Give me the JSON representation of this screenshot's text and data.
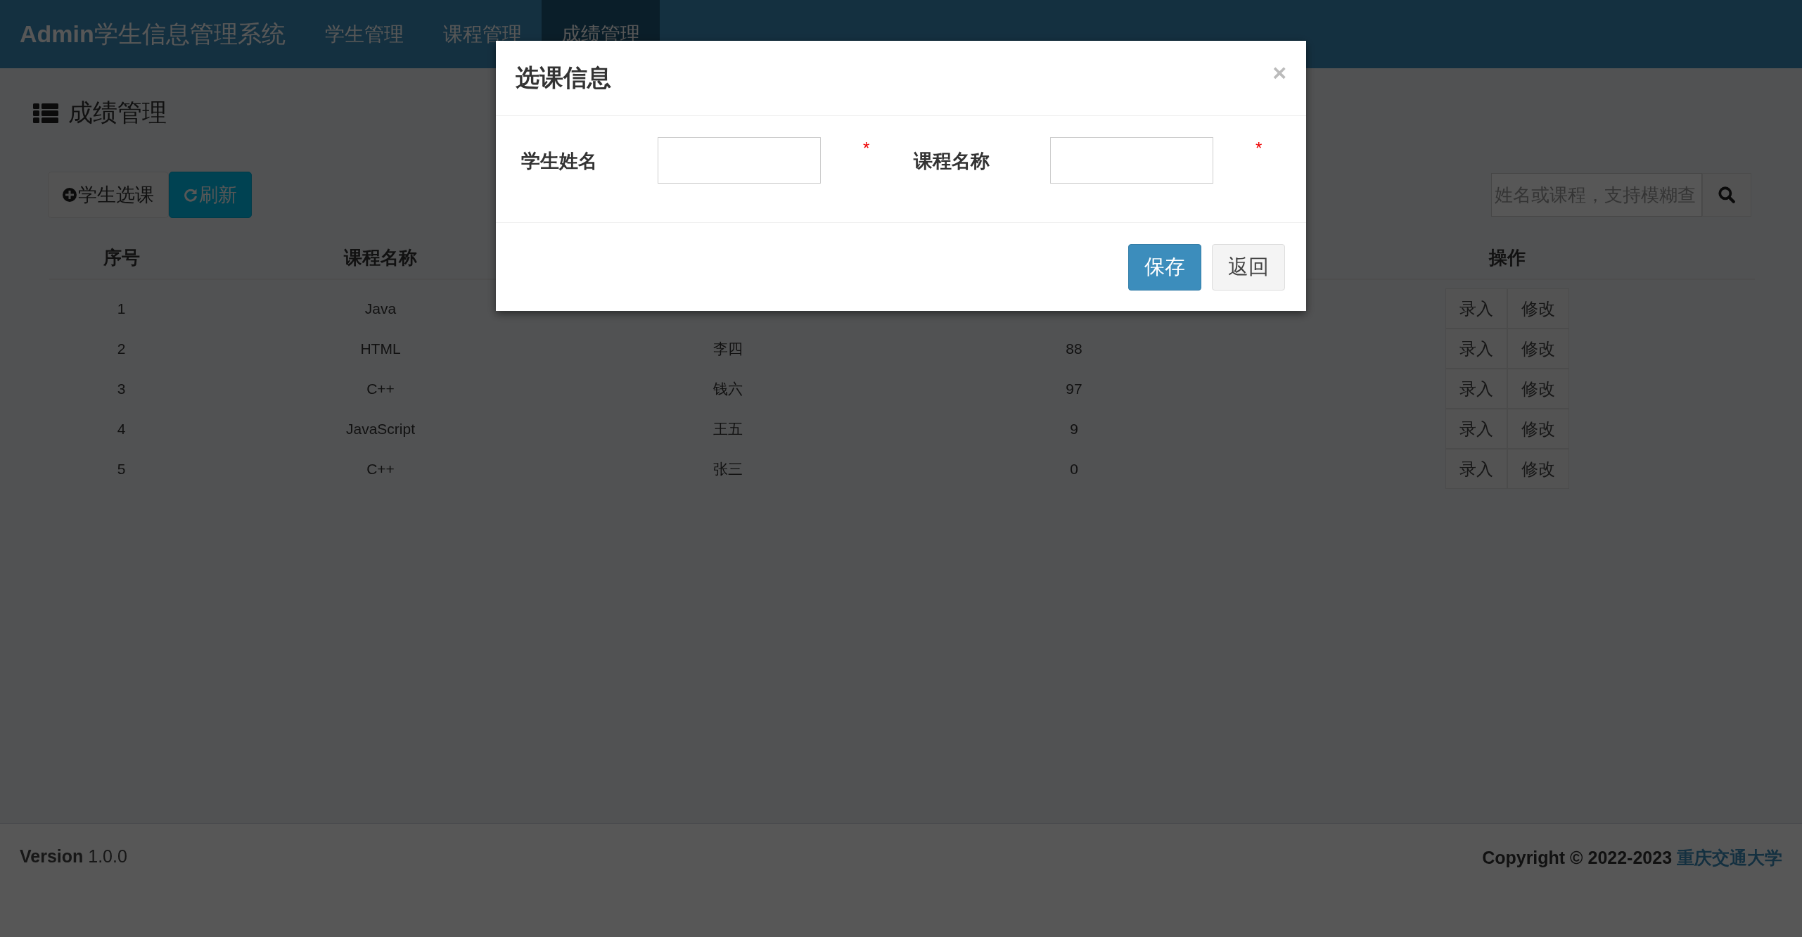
{
  "navbar": {
    "brand_bold": "Admin",
    "brand": "学生信息管理系统",
    "items": [
      {
        "label": "学生管理",
        "selected": false
      },
      {
        "label": "课程管理",
        "selected": false
      },
      {
        "label": "成绩管理",
        "selected": true
      }
    ]
  },
  "page": {
    "title": "成绩管理"
  },
  "toolbar": {
    "buttons": [
      {
        "label": "学生选课",
        "kind": "add"
      },
      {
        "label": "刷新",
        "kind": "refresh"
      }
    ],
    "search": {
      "placeholder": "姓名或课程，支持模糊查"
    }
  },
  "table": {
    "columns": [
      "序号",
      "课程名称",
      null,
      null,
      "操作"
    ],
    "rows": [
      {
        "cells": [
          "1",
          "Java",
          null,
          null
        ],
        "actions": [
          "录入",
          "修改"
        ]
      },
      {
        "cells": [
          "2",
          "HTML",
          "李四",
          "88"
        ],
        "actions": [
          "录入",
          "修改"
        ]
      },
      {
        "cells": [
          "3",
          "C++",
          "钱六",
          "97"
        ],
        "actions": [
          "录入",
          "修改"
        ]
      },
      {
        "cells": [
          "4",
          "JavaScript",
          "王五",
          "9"
        ],
        "actions": [
          "录入",
          "修改"
        ]
      },
      {
        "cells": [
          "5",
          "C++",
          "张三",
          "0"
        ],
        "actions": [
          "录入",
          "修改"
        ]
      }
    ]
  },
  "footer": {
    "version_label": "Version",
    "version": "1.0.0",
    "copyright": "Copyright © 2022-2023",
    "link": "重庆交通大学"
  },
  "modal": {
    "title": "选课信息",
    "close": "×",
    "fields": [
      {
        "label": "学生姓名",
        "required_mark": "*"
      },
      {
        "label": "课程名称",
        "required_mark": "*"
      }
    ],
    "buttons": [
      {
        "label": "保存",
        "kind": "primary"
      },
      {
        "label": "返回",
        "kind": "default"
      }
    ]
  }
}
